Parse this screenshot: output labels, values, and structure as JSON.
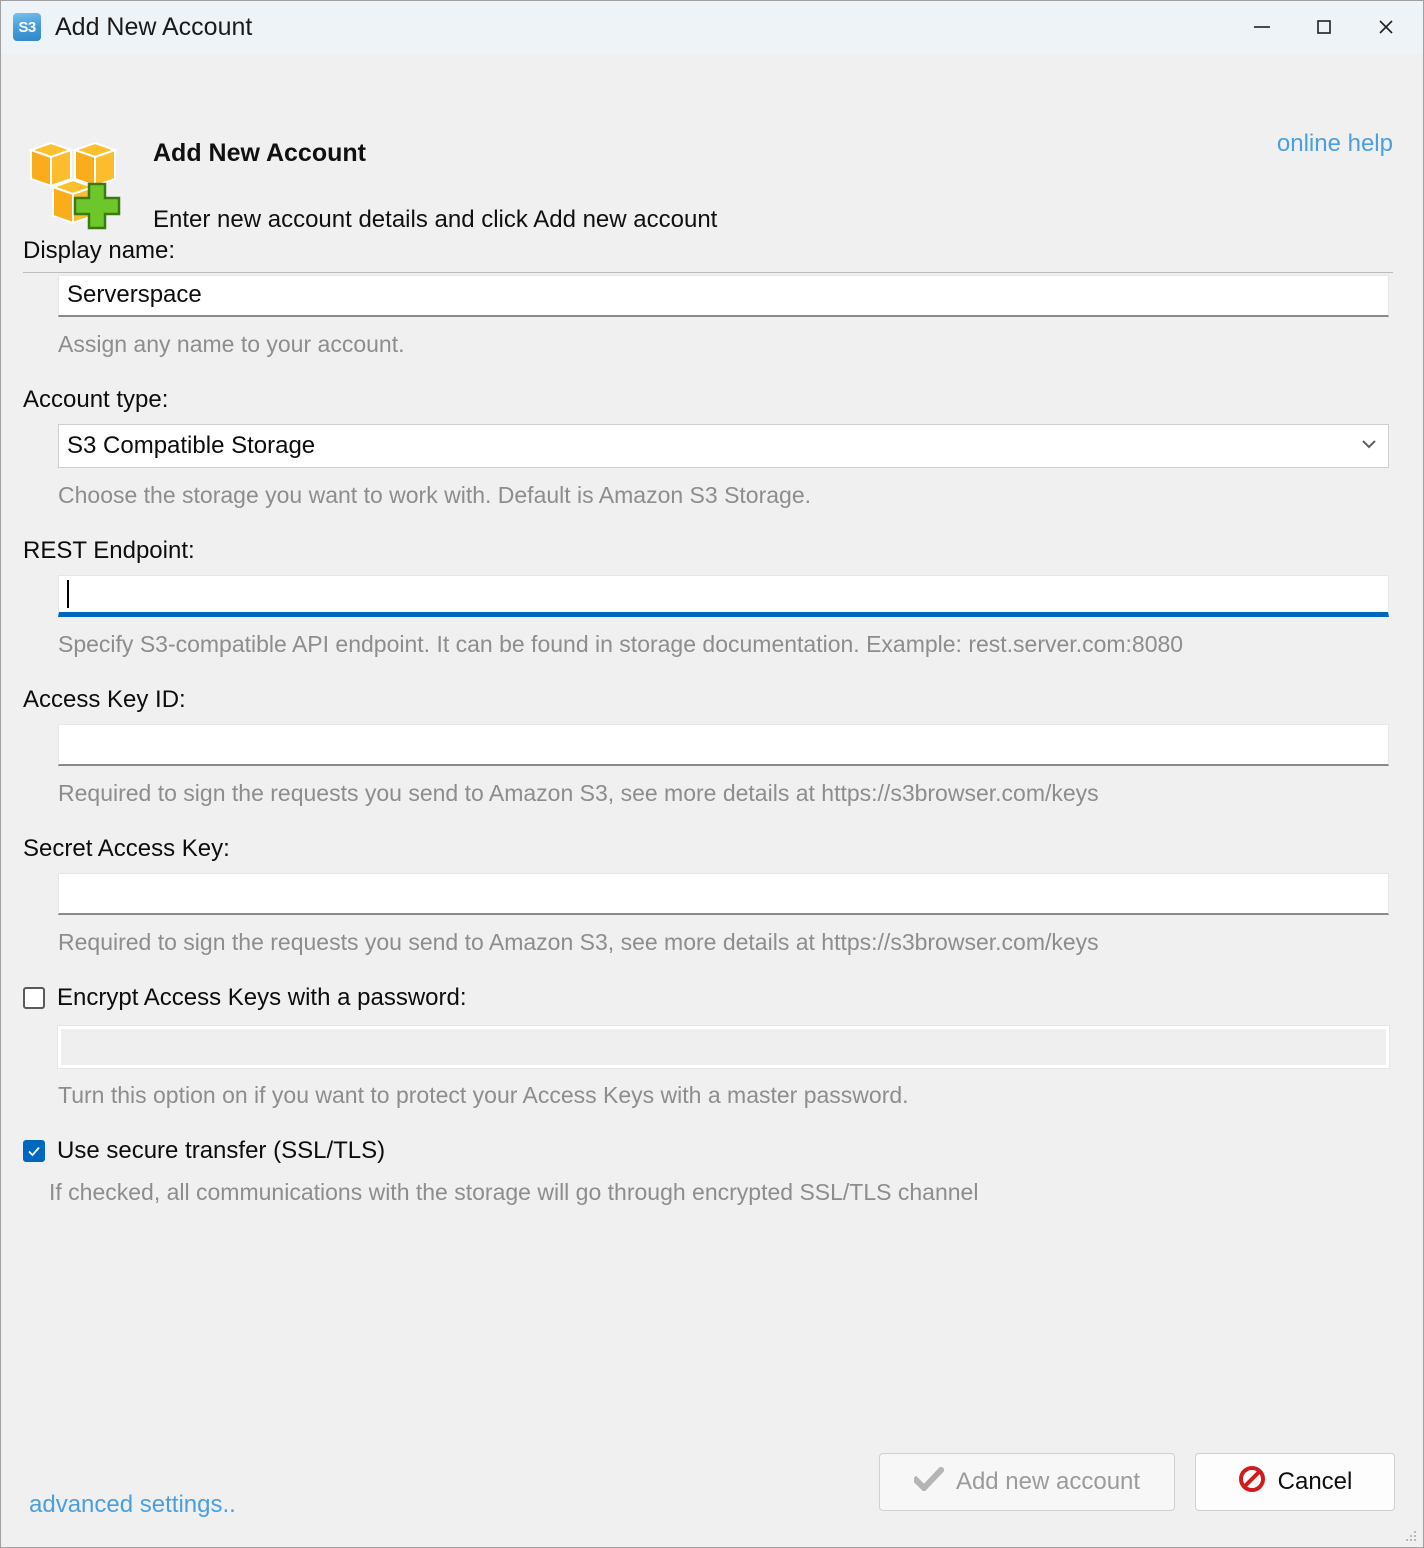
{
  "window": {
    "title": "Add New Account",
    "app_icon": "s3-app-icon",
    "controls": {
      "minimize": "minimize-icon",
      "maximize": "maximize-icon",
      "close": "close-icon"
    }
  },
  "header": {
    "logo": "s3-buckets-add-logo",
    "title": "Add New Account",
    "subtitle": "Enter new account details and click Add new account",
    "online_help": "online help"
  },
  "fields": {
    "display_name": {
      "label": "Display name:",
      "value": "Serverspace",
      "hint": "Assign any name to your account."
    },
    "account_type": {
      "label": "Account type:",
      "value": "S3 Compatible Storage",
      "hint": "Choose the storage you want to work with. Default is Amazon S3 Storage.",
      "chevron": "chevron-down-icon"
    },
    "rest_endpoint": {
      "label": "REST Endpoint:",
      "value": "",
      "hint": "Specify S3-compatible API endpoint. It can be found in storage documentation. Example: rest.server.com:8080"
    },
    "access_key_id": {
      "label": "Access Key ID:",
      "value": "",
      "hint": "Required to sign the requests you send to Amazon S3, see more details at https://s3browser.com/keys"
    },
    "secret_access_key": {
      "label": "Secret Access Key:",
      "value": "",
      "hint": "Required to sign the requests you send to Amazon S3, see more details at https://s3browser.com/keys"
    },
    "encrypt_keys": {
      "label": "Encrypt Access Keys with a password:",
      "checked": false,
      "password_value": "",
      "hint": "Turn this option on if you want to protect your Access Keys with a master password."
    },
    "secure_transfer": {
      "label": "Use secure transfer (SSL/TLS)",
      "checked": true,
      "hint": "If checked, all communications with the storage will go through encrypted SSL/TLS channel"
    }
  },
  "footer": {
    "advanced_settings": "advanced settings..",
    "add_button": "Add new account",
    "add_button_icon": "checkmark-icon",
    "cancel_button": "Cancel",
    "cancel_button_icon": "cancel-prohibition-icon"
  },
  "colors": {
    "accent_blue": "#0067c0",
    "link_blue": "#4a9fe0",
    "window_bg": "#f0f0f0",
    "titlebar_bg": "#eef3f8",
    "hint_grey": "#8d8d8d",
    "cancel_red": "#d01c1c"
  }
}
